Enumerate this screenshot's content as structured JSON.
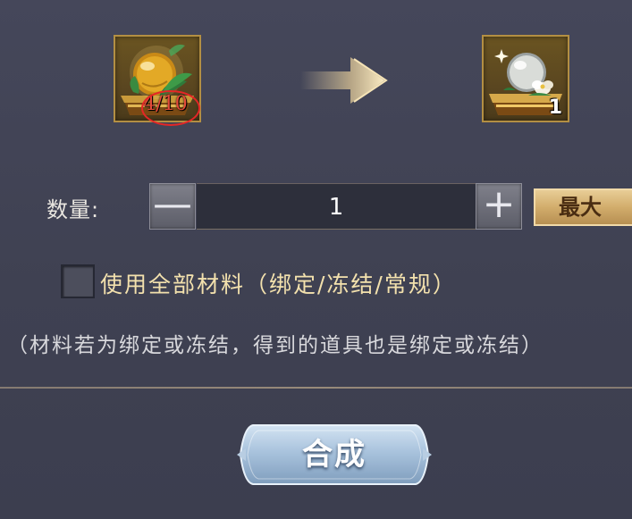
{
  "craft": {
    "source_item": {
      "icon": "golden-crystal-orb-on-chest",
      "count_text": "4/10",
      "count_highlight_color": "#e52626"
    },
    "arrow_icon": "arrow-right-icon",
    "result_item": {
      "icon": "white-pearl-orb-with-lotus-on-chest",
      "count_text": "1"
    }
  },
  "quantity": {
    "label": "数量:",
    "minus_symbol": "—",
    "value": "1",
    "plus_symbol": "+",
    "max_label": "最大"
  },
  "use_all_materials": {
    "checked": false,
    "label": "使用全部材料（绑定/冻结/常规）"
  },
  "note": "（材料若为绑定或冻结，得到的道具也是绑定或冻结）",
  "synthesize_label": "合成",
  "colors": {
    "background": "#42444f",
    "slot_border": "#b38f43",
    "checkbox_label": "#f3e1ad",
    "max_button": "#d2ad6c",
    "synth_button": "#a9c3dd"
  }
}
